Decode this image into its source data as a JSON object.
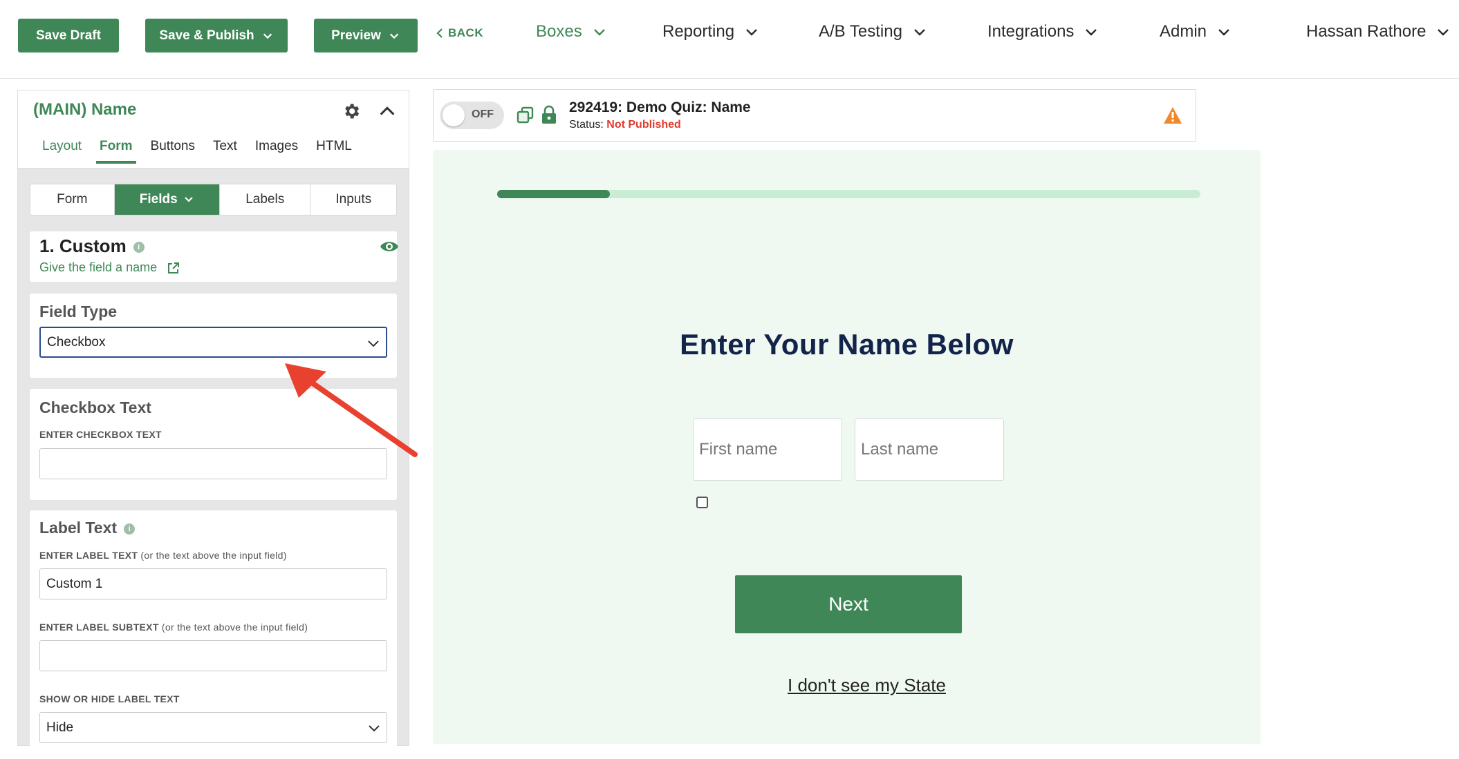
{
  "toolbar": {
    "save_draft": "Save Draft",
    "save_publish": "Save & Publish",
    "preview": "Preview",
    "back": "BACK"
  },
  "nav": {
    "boxes": "Boxes",
    "reporting": "Reporting",
    "ab_testing": "A/B Testing",
    "integrations": "Integrations",
    "admin": "Admin",
    "user": "Hassan Rathore"
  },
  "panel": {
    "title": "(MAIN) Name",
    "tabs": [
      "Layout",
      "Form",
      "Buttons",
      "Text",
      "Images",
      "HTML"
    ],
    "active_tab": "Form",
    "subtabs": [
      "Form",
      "Fields",
      "Labels",
      "Inputs"
    ],
    "active_subtab": "Fields",
    "field": {
      "title": "1. Custom",
      "rename_link": "Give the field a name"
    },
    "field_type": {
      "heading": "Field Type",
      "value": "Checkbox"
    },
    "checkbox_text": {
      "heading": "Checkbox Text",
      "caption": "ENTER CHECKBOX TEXT",
      "value": ""
    },
    "label_text": {
      "heading": "Label Text",
      "caption": "ENTER LABEL TEXT",
      "caption_note": "(or the text above the input field)",
      "value": "Custom 1",
      "subtext_caption": "ENTER LABEL SUBTEXT",
      "subtext_note": "(or the text above the input field)",
      "subtext_value": "",
      "show_hide_caption": "SHOW OR HIDE LABEL TEXT",
      "show_hide_value": "Hide"
    }
  },
  "status": {
    "toggle": "OFF",
    "title": "292419: Demo Quiz: Name",
    "status_label": "Status:",
    "status_value": "Not Published"
  },
  "preview": {
    "progress": 0.16,
    "heading": "Enter Your Name Below",
    "first_placeholder": "First name",
    "last_placeholder": "Last name",
    "next_button": "Next",
    "link": "I don't see my State"
  },
  "colors": {
    "brand_green": "#3f8757",
    "preview_bg": "#eff9f2",
    "heading_navy": "#13234a",
    "alert_red": "#e23b2e",
    "warning_orange": "#f0892d",
    "annotation_arrow": "#e8412f"
  }
}
